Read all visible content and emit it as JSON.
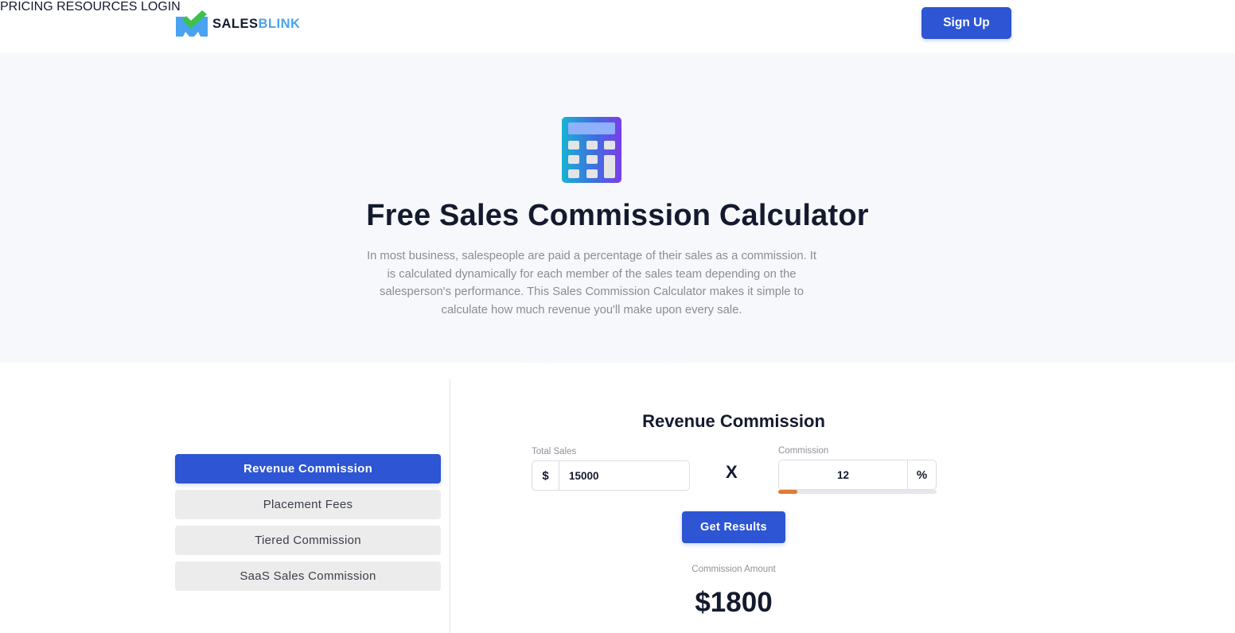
{
  "header": {
    "brand": {
      "part1": "SALES",
      "part2": "BLINK"
    },
    "nav": [
      {
        "label": "PRICING"
      },
      {
        "label": "RESOURCES"
      },
      {
        "label": "LOGIN"
      }
    ],
    "signup_label": "Sign Up"
  },
  "hero": {
    "icon": "calculator-icon",
    "title": "Free Sales Commission Calculator",
    "description": "In most business, salespeople are paid a percentage of their sales as a commission. It is calculated dynamically for each member of the sales team depending on the salesperson's performance. This Sales Commission Calculator makes it simple to calculate how much revenue you'll make upon every sale."
  },
  "sidebar": {
    "tabs": [
      {
        "label": "Revenue Commission",
        "active": true
      },
      {
        "label": "Placement Fees",
        "active": false
      },
      {
        "label": "Tiered Commission",
        "active": false
      },
      {
        "label": "SaaS Sales Commission",
        "active": false
      }
    ]
  },
  "calculator": {
    "title": "Revenue Commission",
    "total_sales": {
      "label": "Total Sales",
      "prefix": "$",
      "value": "15000"
    },
    "operator": "X",
    "commission": {
      "label": "Commission",
      "value": "12",
      "suffix": "%",
      "slider_percent": 12
    },
    "button_label": "Get Results",
    "result_label": "Commission Amount",
    "result_currency": "$",
    "result_value": "1800"
  },
  "colors": {
    "accent": "#2d55d4",
    "slider_fill": "#e07a35",
    "hero_bg": "#f7f8fc",
    "brand_blue": "#4aa3f0",
    "brand_green": "#3cc14b"
  }
}
